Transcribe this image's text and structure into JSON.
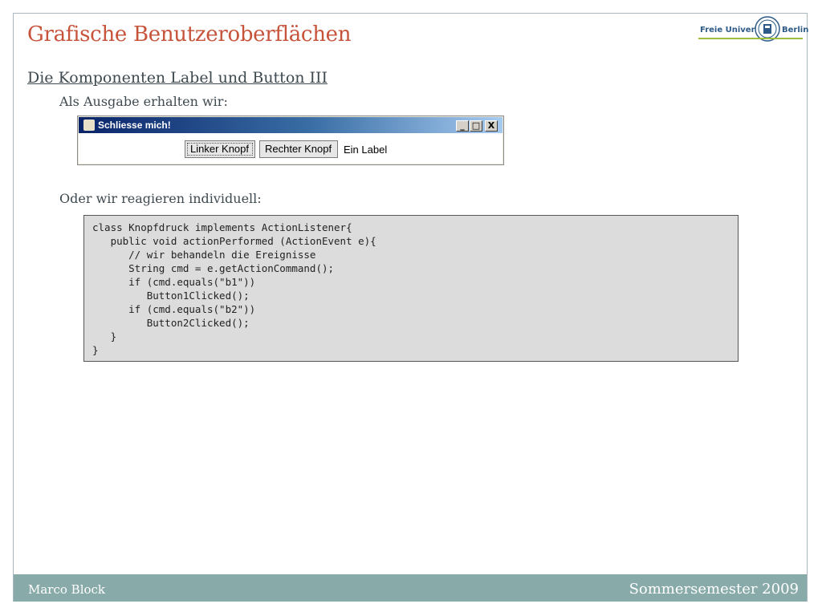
{
  "slide": {
    "title": "Grafische Benutzeroberflächen",
    "subtitle": "Die Komponenten Label und Button III",
    "text_output": "Als Ausgabe erhalten wir:",
    "text_individual": "Oder wir reagieren individuell:"
  },
  "logo": {
    "left_text": "Freie Universität",
    "right_text": "Berlin",
    "icon": "university-seal-icon"
  },
  "java_window": {
    "title": "Schliesse mich!",
    "icon": "java-cup-icon",
    "controls": [
      "_",
      "□",
      "X"
    ],
    "button1": "Linker Knopf",
    "button2": "Rechter Knopf",
    "label": "Ein Label"
  },
  "code": {
    "lines": [
      "class Knopfdruck implements ActionListener{",
      "   public void actionPerformed (ActionEvent e){",
      "      // wir behandeln die Ereignisse",
      "      String cmd = e.getActionCommand();",
      "      if (cmd.equals(\"b1\"))",
      "         Button1Clicked();",
      "      if (cmd.equals(\"b2\"))",
      "         Button2Clicked();",
      "   }",
      "}"
    ]
  },
  "footer": {
    "author": "Marco Block",
    "semester": "Sommersemester 2009"
  },
  "colors": {
    "title": "#c6533a",
    "footer_bg": "#88aaa9",
    "code_bg": "#dcdcdc"
  }
}
